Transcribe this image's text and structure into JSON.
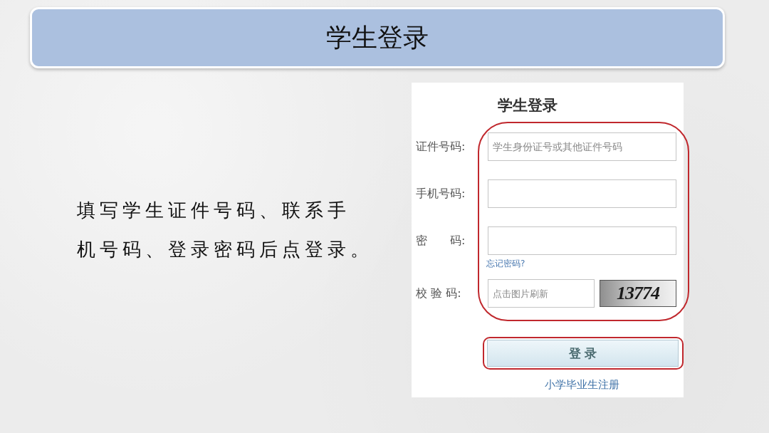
{
  "slide": {
    "title": "学生登录"
  },
  "instruction_lines": [
    "填写学生证件号码、联系手",
    "机号码、登录密码后点登录。"
  ],
  "login_form": {
    "title": "学生登录",
    "highlighted": true,
    "fields": [
      {
        "kind": "text",
        "label": "证件号码:",
        "placeholder": "学生身份证号或其他证件号码"
      },
      {
        "kind": "text",
        "label": "手机号码:"
      },
      {
        "kind": "password",
        "label": "密　　码:",
        "link": "忘记密码?"
      },
      {
        "kind": "captcha",
        "label": "校 验 码:",
        "placeholder": "点击图片刷新",
        "captcha": "13774"
      }
    ],
    "login_button": {
      "label": "登 录",
      "highlighted": true
    },
    "register_link": "小学毕业生注册"
  }
}
